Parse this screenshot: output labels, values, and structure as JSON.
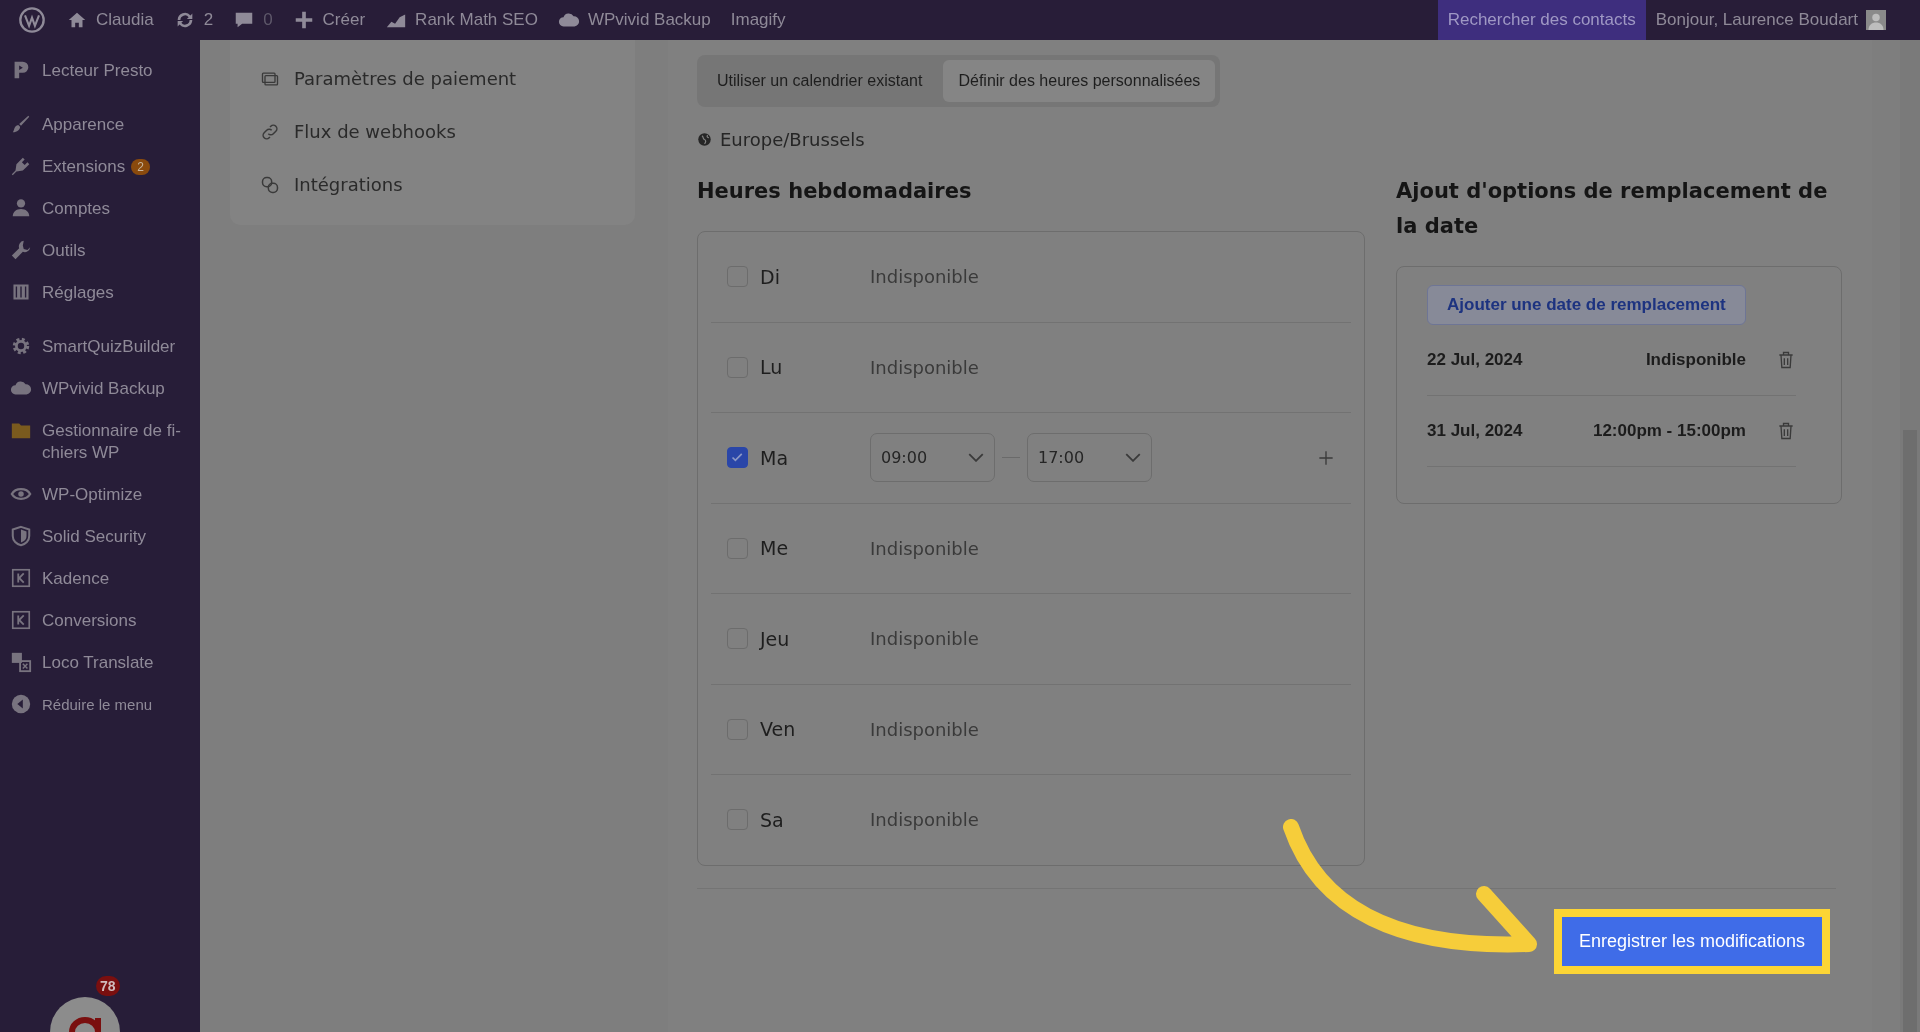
{
  "admin_bar": {
    "items": [
      {
        "kind": "wp"
      },
      {
        "kind": "home",
        "label": "Claudia"
      },
      {
        "kind": "updates",
        "label": "2"
      },
      {
        "kind": "comments",
        "label": "0"
      },
      {
        "kind": "new",
        "label": "Créer"
      },
      {
        "kind": "chart",
        "label": "Rank Math SEO"
      },
      {
        "kind": "cloud",
        "label": "WPvivid Backup"
      },
      {
        "kind": "text",
        "label": "Imagify"
      }
    ],
    "search_contacts": "Rechercher des contacts",
    "greeting": "Bonjour, Laurence Boudart"
  },
  "sidebar": {
    "groups": [
      [
        {
          "kind": "play",
          "label": "Lecteur Presto"
        }
      ],
      [
        {
          "kind": "brush",
          "label": "Apparence"
        },
        {
          "kind": "plug",
          "label": "Extensions",
          "badge": "2"
        },
        {
          "kind": "user",
          "label": "Comptes"
        },
        {
          "kind": "wrench",
          "label": "Outils"
        },
        {
          "kind": "sliders",
          "label": "Réglages"
        }
      ],
      [
        {
          "kind": "gear",
          "label": "SmartQuizBuilder"
        },
        {
          "kind": "cloud",
          "label": "WPvivid Backup"
        },
        {
          "kind": "folder",
          "label": "Gestionnaire de fi-chiers WP"
        },
        {
          "kind": "eye",
          "label": "WP-Optimize"
        },
        {
          "kind": "shield",
          "label": "Solid Security"
        },
        {
          "kind": "k",
          "label": "Kadence"
        },
        {
          "kind": "k",
          "label": "Conversions"
        },
        {
          "kind": "translate",
          "label": "Loco Translate"
        },
        {
          "kind": "collapse",
          "label": "Réduire le menu"
        }
      ]
    ],
    "widget_badge": "78"
  },
  "settings_nav": {
    "items": [
      {
        "kind": "payment",
        "label": "Paramètres de paiement"
      },
      {
        "kind": "link",
        "label": "Flux de webhooks"
      },
      {
        "kind": "integrations",
        "label": "Intégrations"
      }
    ]
  },
  "schedule_mode": {
    "options": [
      {
        "label": "Utiliser un calendrier existant",
        "selected": false
      },
      {
        "label": "Définir des heures personnalisées",
        "selected": true
      }
    ]
  },
  "timezone": "Europe/Brussels",
  "weekly_hours": {
    "heading": "Heures hebdomadaires",
    "days": [
      {
        "label": "Di",
        "checked": false,
        "status": "Indisponible"
      },
      {
        "label": "Lu",
        "checked": false,
        "status": "Indisponible"
      },
      {
        "label": "Ma",
        "checked": true,
        "start": "09:00",
        "end": "17:00"
      },
      {
        "label": "Me",
        "checked": false,
        "status": "Indisponible"
      },
      {
        "label": "Jeu",
        "checked": false,
        "status": "Indisponible"
      },
      {
        "label": "Ven",
        "checked": false,
        "status": "Indisponible"
      },
      {
        "label": "Sa",
        "checked": false,
        "status": "Indisponible"
      }
    ]
  },
  "date_overrides": {
    "heading": "Ajout d'options de remplacement de la date",
    "add_button": "Ajouter une date de remplacement",
    "entries": [
      {
        "date": "22 Jul, 2024",
        "hours": "Indisponible"
      },
      {
        "date": "31 Jul, 2024",
        "hours": "12:00pm - 15:00pm"
      }
    ]
  },
  "save_button": {
    "label": "Enregistrer les modifications",
    "highlighted": true
  }
}
